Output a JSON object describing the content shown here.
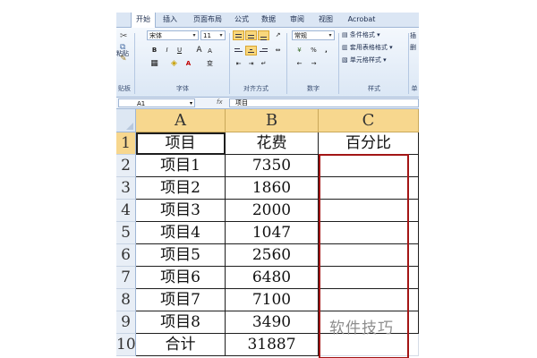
{
  "ribbon": {
    "tabs": [
      {
        "label": "开始",
        "active": true
      },
      {
        "label": "插入"
      },
      {
        "label": "页面布局"
      },
      {
        "label": "公式"
      },
      {
        "label": "数据"
      },
      {
        "label": "审阅"
      },
      {
        "label": "视图"
      },
      {
        "label": "Acrobat"
      }
    ],
    "font_name": "宋体",
    "font_size": "11",
    "number_format": "常规",
    "percent_symbol": "%",
    "comma_symbol": ",",
    "bold": "B",
    "italic": "I",
    "underline": "U",
    "font_color_btn": "A",
    "bigger_font": "A",
    "smaller_font": "A",
    "wen": "变",
    "cond_format": "条件格式",
    "table_format": "套用表格格式",
    "cell_style": "单元格样式",
    "insert": "插",
    "delete": "删",
    "paste_label": "粘贴",
    "groups": {
      "clipboard": "贴板",
      "font": "字体",
      "alignment": "对齐方式",
      "number": "数字",
      "styles": "样式",
      "cells": "单"
    }
  },
  "formula_bar": {
    "name_box": "A1",
    "fx": "fx",
    "formula": "项目"
  },
  "sheet": {
    "columns": [
      "A",
      "B",
      "C"
    ],
    "rows": [
      {
        "num": "1",
        "a": "项目",
        "b": "花费",
        "c": "百分比"
      },
      {
        "num": "2",
        "a": "项目1",
        "b": "7350",
        "c": ""
      },
      {
        "num": "3",
        "a": "项目2",
        "b": "1860",
        "c": ""
      },
      {
        "num": "4",
        "a": "项目3",
        "b": "2000",
        "c": ""
      },
      {
        "num": "5",
        "a": "项目4",
        "b": "1047",
        "c": ""
      },
      {
        "num": "6",
        "a": "项目5",
        "b": "2560",
        "c": ""
      },
      {
        "num": "7",
        "a": "项目6",
        "b": "6480",
        "c": ""
      },
      {
        "num": "8",
        "a": "项目7",
        "b": "7100",
        "c": ""
      },
      {
        "num": "9",
        "a": "项目8",
        "b": "3490",
        "c": ""
      },
      {
        "num": "10",
        "a": "合计",
        "b": "31887",
        "c": ""
      }
    ]
  },
  "watermark": "软件技巧",
  "colors": {
    "selection_outline": "#a31515",
    "column_header_selected": "#f7d78e"
  }
}
